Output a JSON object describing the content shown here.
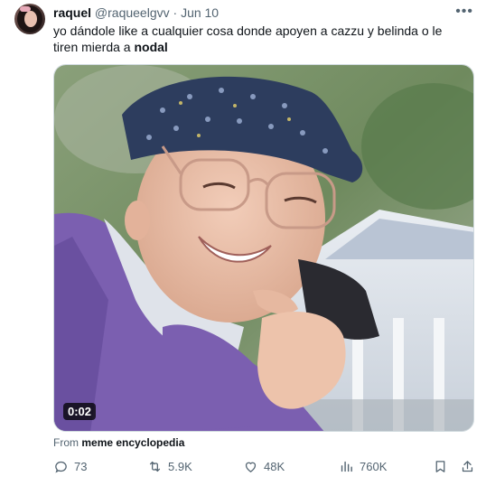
{
  "author": {
    "name": "raquel",
    "handle": "@raqueelgvv",
    "separator": "·",
    "date": "Jun 10"
  },
  "more_icon": "•••",
  "tweet": {
    "text_main": "yo dándole like a cualquier cosa donde apoyen a cazzu y belinda o le tiren mierda a ",
    "text_bold": "nodal"
  },
  "media": {
    "duration": "0:02",
    "source_prefix": "From ",
    "source_name": "meme encyclopedia"
  },
  "actions": {
    "replies": "73",
    "retweets": "5.9K",
    "likes": "48K",
    "views": "760K"
  },
  "icons": [
    "reply-icon",
    "retweet-icon",
    "like-icon",
    "views-icon",
    "bookmark-icon",
    "share-icon"
  ]
}
